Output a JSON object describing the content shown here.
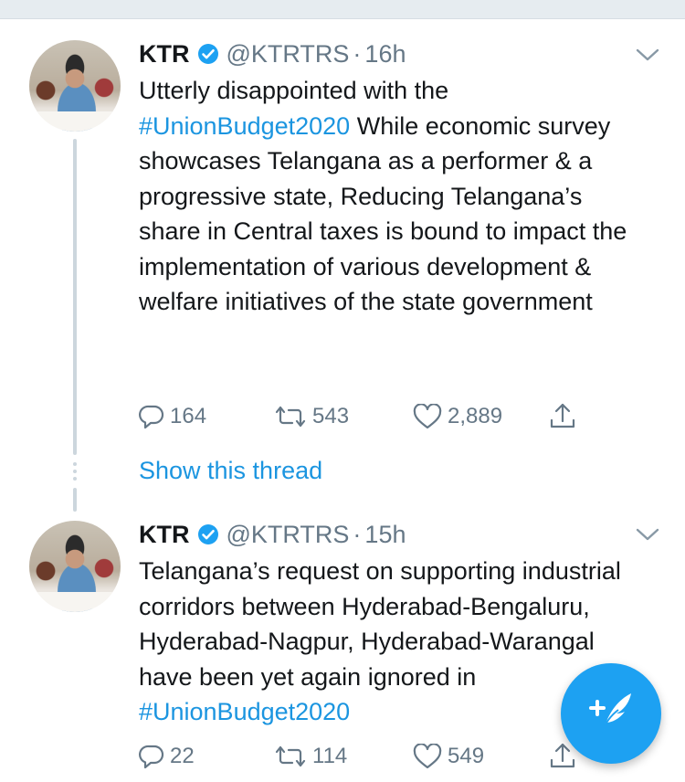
{
  "tweets": [
    {
      "author": "KTR",
      "handle": "@KTRTRS",
      "separator": "·",
      "time": "16h",
      "text_parts": [
        "Utterly disappointed with the ",
        "#UnionBudget2020",
        " While economic survey showcases Telangana as a performer & a progressive state, Reducing Telangana’s share in Central taxes is bound to impact the implementation of various development & welfare initiatives of the state government"
      ],
      "replies": "164",
      "retweets": "543",
      "likes": "2,889",
      "show_thread": "Show this thread"
    },
    {
      "author": "KTR",
      "handle": "@KTRTRS",
      "separator": "·",
      "time": "15h",
      "text_parts": [
        "Telangana’s request on supporting industrial corridors between Hyderabad-Bengaluru, Hyderabad-Nagpur, Hyderabad-Warangal have been yet again ignored in ",
        "#UnionBudget2020"
      ],
      "replies": "22",
      "retweets": "114",
      "likes": "549"
    }
  ],
  "icons": {
    "verified": "verified-badge-icon",
    "caret": "chevron-down-icon",
    "reply": "reply-icon",
    "retweet": "retweet-icon",
    "like": "heart-icon",
    "share": "share-icon",
    "compose": "compose-tweet-icon"
  },
  "colors": {
    "link": "#1b95e0",
    "secondary_text": "#657786",
    "fab": "#1da1f2"
  }
}
